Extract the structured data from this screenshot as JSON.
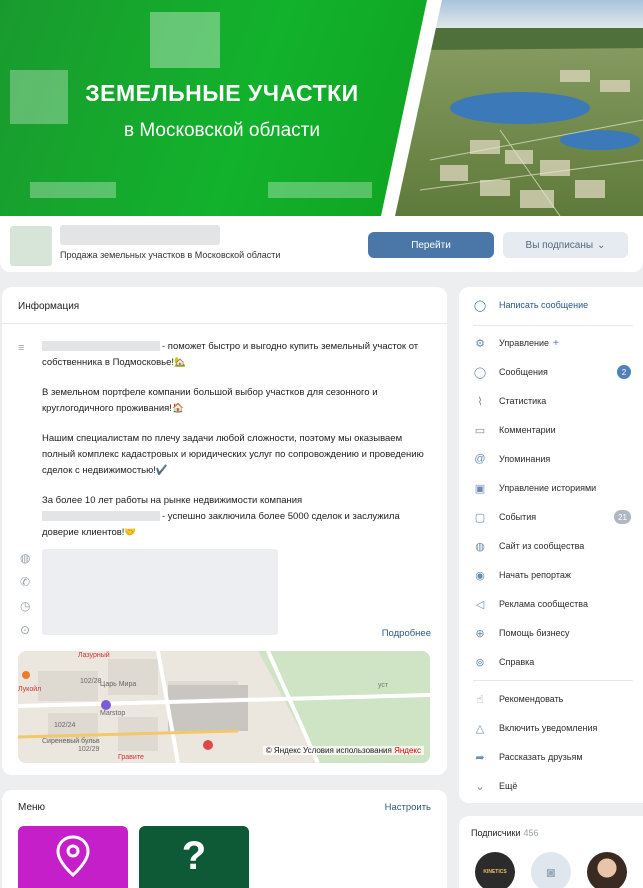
{
  "cover": {
    "title": "ЗЕМЕЛЬНЫЕ УЧАСТКИ",
    "subtitle": "в Московской области"
  },
  "header": {
    "status": "Продажа земельных участков в Московской области",
    "go_button": "Перейти",
    "subscribed_button": "Вы подписаны"
  },
  "info": {
    "heading": "Информация",
    "paragraphs": [
      "- поможет быстро и выгодно купить земельный участок от собственника в Подмосковье!🏡",
      "В земельном портфеле компании большой выбор участков для сезонного и круглогодичного проживания!🏠",
      "Нашим специалистам по плечу задачи любой сложности, поэтому мы оказываем полный комплекс кадастровых и юридических услуг по сопровождению и проведению сделок с недвижимостью!✔️",
      "За более 10 лет работы на рынке недвижимости компания",
      "- успешно заключила более 5000 сделок и заслужила доверие клиентов!🤝"
    ],
    "more_link": "Подробнее",
    "map_credit": "© Яндекс Условия использования",
    "map_brand": "Яндекс",
    "map_labels": {
      "lazurny": "Лазурный",
      "district": "Царь Мира",
      "metro": "Marstop",
      "street1": "Сиреневый бульв",
      "street2": "Гравите",
      "num1": "102/28",
      "num2": "102/24",
      "num3": "102/29",
      "ust": "уст",
      "fuel": "Лукойл"
    }
  },
  "menu": {
    "heading": "Меню",
    "configure": "Настроить"
  },
  "sidebar": {
    "items": [
      {
        "label": "Написать сообщение",
        "icon": "chat-icon"
      },
      {
        "label": "Управление",
        "icon": "gear-icon"
      },
      {
        "label": "Сообщения",
        "icon": "message-icon",
        "badge": "2"
      },
      {
        "label": "Статистика",
        "icon": "chart-icon"
      },
      {
        "label": "Комментарии",
        "icon": "comment-icon"
      },
      {
        "label": "Упоминания",
        "icon": "at-icon"
      },
      {
        "label": "Управление историями",
        "icon": "story-icon"
      },
      {
        "label": "События",
        "icon": "event-icon",
        "badge": "21"
      },
      {
        "label": "Сайт из сообщества",
        "icon": "globe-icon"
      },
      {
        "label": "Начать репортаж",
        "icon": "live-icon"
      },
      {
        "label": "Реклама сообщества",
        "icon": "megaphone-icon"
      },
      {
        "label": "Помощь бизнесу",
        "icon": "help-business-icon"
      },
      {
        "label": "Справка",
        "icon": "help-icon"
      },
      {
        "label": "Рекомендовать",
        "icon": "thumb-up-icon"
      },
      {
        "label": "Включить уведомления",
        "icon": "bell-icon"
      },
      {
        "label": "Рассказать друзьям",
        "icon": "share-icon"
      },
      {
        "label": "Ещё",
        "icon": "chevron-down-icon"
      }
    ],
    "plus": "+"
  },
  "subscribers": {
    "heading": "Подписчики",
    "count": "456",
    "first_avatar_text": "KINETICS"
  },
  "colors": {
    "accent": "#4a76a8",
    "cover_green": "#12b22c",
    "tile_pink": "#c41fc9",
    "tile_green": "#0f5a36"
  }
}
